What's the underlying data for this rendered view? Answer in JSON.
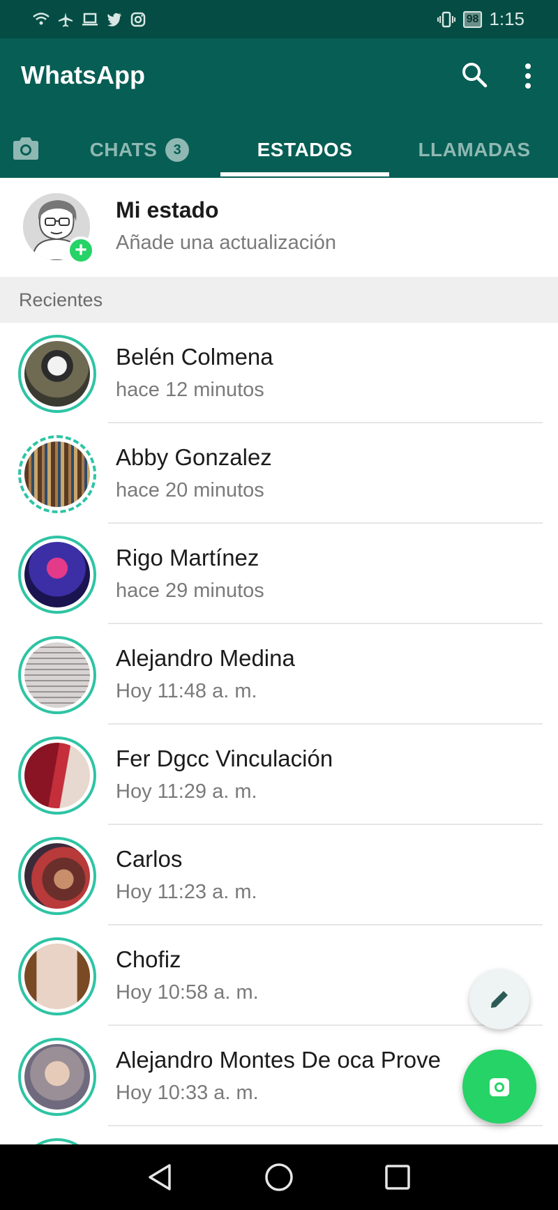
{
  "status_bar": {
    "time": "1:15",
    "battery": "98",
    "left_icons": [
      "wifi-icon",
      "airplane-icon",
      "laptop-icon",
      "twitter-icon",
      "instagram-icon"
    ],
    "right_icons": [
      "vibrate-icon",
      "battery-icon"
    ]
  },
  "app_bar": {
    "title": "WhatsApp",
    "actions": [
      "search-icon",
      "more-vert-icon"
    ]
  },
  "tabs": {
    "camera_icon": "camera-icon",
    "chats_label": "CHATS",
    "chats_badge": "3",
    "estados_label": "ESTADOS",
    "llamadas_label": "LLAMADAS",
    "selected": "ESTADOS"
  },
  "my_status": {
    "name": "Mi estado",
    "subtitle": "Añade una actualización"
  },
  "section": {
    "recent_header": "Recientes"
  },
  "statuses": [
    {
      "name": "Belén Colmena",
      "time": "hace 12 minutos"
    },
    {
      "name": "Abby Gonzalez",
      "time": "hace 20 minutos"
    },
    {
      "name": "Rigo Martínez",
      "time": "hace 29 minutos"
    },
    {
      "name": "Alejandro Medina",
      "time": "Hoy 11:48 a. m."
    },
    {
      "name": "Fer Dgcc Vinculación",
      "time": "Hoy 11:29 a. m."
    },
    {
      "name": "Carlos",
      "time": "Hoy 11:23 a. m."
    },
    {
      "name": "Chofiz",
      "time": "Hoy 10:58 a. m."
    },
    {
      "name": "Alejandro Montes De oca Prove",
      "time": "Hoy 10:33 a. m."
    }
  ],
  "fabs": [
    "pencil-icon",
    "camera-icon"
  ],
  "nav_bar": [
    "back-icon",
    "home-icon",
    "recents-icon"
  ],
  "colors": {
    "primary": "#075e54",
    "status_bar": "#054d44",
    "accent": "#25d366",
    "ring": "#2ec4a4"
  }
}
